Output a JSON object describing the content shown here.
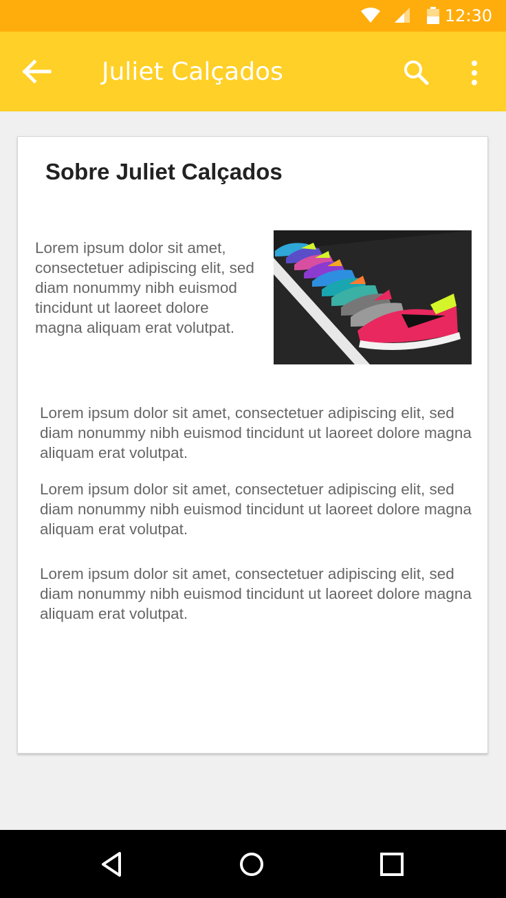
{
  "status_bar": {
    "time": "12:30",
    "icons": [
      "wifi-icon",
      "signal-icon",
      "battery-icon"
    ]
  },
  "app_bar": {
    "title": "Juliet Calçados",
    "icons": [
      "back-arrow-icon",
      "search-icon",
      "more-vert-icon"
    ]
  },
  "card": {
    "title": "Sobre Juliet Calçados",
    "intro": "Lorem ipsum dolor sit amet, consectetuer adipiscing elit, sed diam nonummy nibh euismod tincidunt ut laoreet dolore magna aliquam erat volutpat.",
    "paragraphs": [
      "Lorem ipsum dolor sit amet, consectetuer adipiscing elit, sed diam nonummy nibh euismod tincidunt ut laoreet dolore magna aliquam erat volutpat.",
      "Lorem ipsum dolor sit amet, consectetuer adipiscing elit, sed diam nonummy nibh euismod tincidunt ut laoreet dolore magna aliquam erat volutpat.",
      "Lorem ipsum dolor sit amet, consectetuer adipiscing elit, sed diam nonummy nibh euismod tincidunt ut laoreet dolore magna aliquam erat volutpat."
    ]
  },
  "nav_bar": {
    "icons": [
      "back-triangle-icon",
      "home-circle-icon",
      "recents-square-icon"
    ]
  },
  "colors": {
    "status_bar": "#ffad0d",
    "app_bar": "#ffd027",
    "background": "#f0f0f0",
    "body_text": "#666666"
  }
}
